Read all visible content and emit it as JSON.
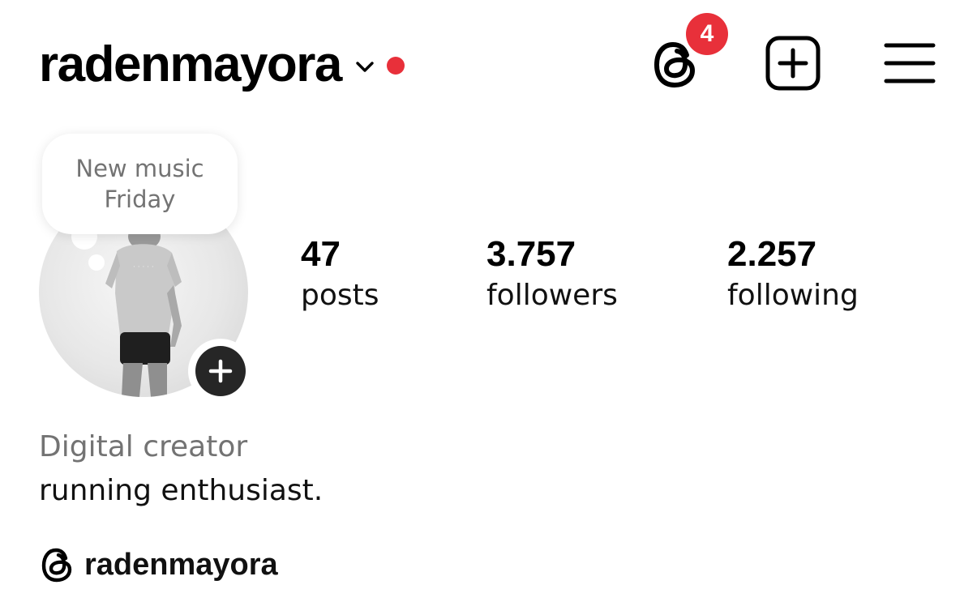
{
  "header": {
    "username": "radenmayora",
    "notification_count": "4",
    "icons": {
      "account_switcher": "chevron-down-icon",
      "unseen_indicator": "red-dot",
      "threads": "threads-icon",
      "create": "plus-square-icon",
      "menu": "hamburger-menu-icon"
    }
  },
  "note": {
    "text": "New music Friday"
  },
  "profile": {
    "avatar": "profile-photo",
    "add_story_icon": "plus-icon",
    "stats": {
      "posts": {
        "value": "47",
        "label": "posts"
      },
      "followers": {
        "value": "3.757",
        "label": "followers"
      },
      "following": {
        "value": "2.257",
        "label": "following"
      }
    },
    "category": "Digital creator",
    "bio": "running enthusiast.",
    "threads_handle": "radenmayora"
  },
  "colors": {
    "text": "#000000",
    "secondary_text": "#737373",
    "badge_red": "#e8303a",
    "dark_button": "#262626",
    "background": "#ffffff"
  }
}
